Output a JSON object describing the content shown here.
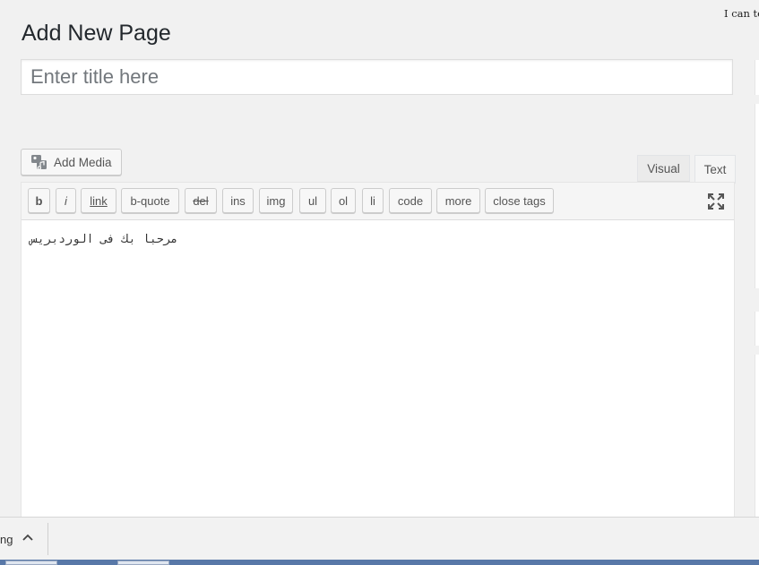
{
  "top_note": "I can te",
  "page_title": "Add New Page",
  "title_field": {
    "value": "",
    "placeholder": "Enter title here"
  },
  "add_media_label": "Add Media",
  "tabs": {
    "visual": "Visual",
    "text": "Text"
  },
  "toolbar": {
    "b": "b",
    "i": "i",
    "link": "link",
    "bquote": "b-quote",
    "del": "del",
    "ins": "ins",
    "img": "img",
    "ul": "ul",
    "ol": "ol",
    "li": "li",
    "code": "code",
    "more": "more",
    "close_tags": "close tags"
  },
  "icons": {
    "media": "media-icon",
    "fullscreen": "fullscreen-icon",
    "caret": "chevron-up-icon"
  },
  "editor_content": "مرحبا بك فى الوردبريس",
  "download_bar": {
    "item_text": "ng"
  },
  "colors": {
    "background": "#f1f1f1",
    "taskbar": "#5878a8"
  }
}
